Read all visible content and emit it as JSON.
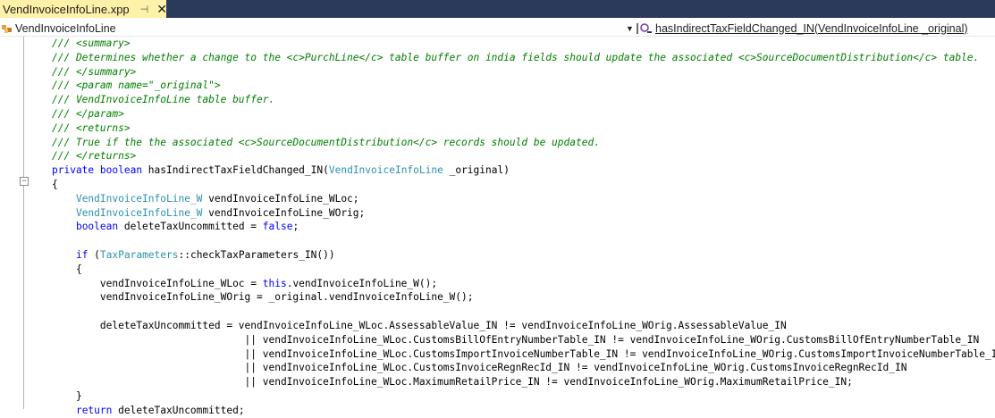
{
  "tab": {
    "title": "VendInvoiceInfoLine.xpp",
    "pin_glyph": "⊣",
    "close_glyph": "✕"
  },
  "nav": {
    "left": "VendInvoiceInfoLine",
    "right": "hasIndirectTaxFieldChanged_IN(VendInvoiceInfoLine _original)"
  },
  "colors": {
    "tabstrip": "#2b3a5b",
    "active_tab": "#fff1a8",
    "comment": "#008000",
    "keyword": "#0000ff",
    "type": "#2b91af"
  },
  "code": [
    [
      {
        "c": "c",
        "t": "/// <summary>"
      }
    ],
    [
      {
        "c": "c",
        "t": "/// Determines whether a change to the <c>PurchLine</c> table buffer on india fields should update the associated <c>SourceDocumentDistribution</c> table."
      }
    ],
    [
      {
        "c": "c",
        "t": "/// </summary>"
      }
    ],
    [
      {
        "c": "c",
        "t": "/// <param name=\"_original\">"
      }
    ],
    [
      {
        "c": "c",
        "t": "/// VendInvoiceInfoLine table buffer."
      }
    ],
    [
      {
        "c": "c",
        "t": "/// </param>"
      }
    ],
    [
      {
        "c": "c",
        "t": "/// <returns>"
      }
    ],
    [
      {
        "c": "c",
        "t": "/// True if the the associated <c>SourceDocumentDistribution</c> records should be updated."
      }
    ],
    [
      {
        "c": "c",
        "t": "/// </returns>"
      }
    ],
    [
      {
        "c": "k",
        "t": "private"
      },
      {
        "c": "",
        "t": " "
      },
      {
        "c": "k",
        "t": "boolean"
      },
      {
        "c": "",
        "t": " hasIndirectTaxFieldChanged_IN("
      },
      {
        "c": "t",
        "t": "VendInvoiceInfoLine"
      },
      {
        "c": "",
        "t": " _original)"
      }
    ],
    [
      {
        "c": "",
        "t": "{"
      }
    ],
    [
      {
        "c": "",
        "t": "    "
      },
      {
        "c": "t",
        "t": "VendInvoiceInfoLine_W"
      },
      {
        "c": "",
        "t": " vendInvoiceInfoLine_WLoc;"
      }
    ],
    [
      {
        "c": "",
        "t": "    "
      },
      {
        "c": "t",
        "t": "VendInvoiceInfoLine_W"
      },
      {
        "c": "",
        "t": " vendInvoiceInfoLine_WOrig;"
      }
    ],
    [
      {
        "c": "",
        "t": "    "
      },
      {
        "c": "k",
        "t": "boolean"
      },
      {
        "c": "",
        "t": " deleteTaxUncommitted = "
      },
      {
        "c": "k",
        "t": "false"
      },
      {
        "c": "",
        "t": ";"
      }
    ],
    [
      {
        "c": "",
        "t": ""
      }
    ],
    [
      {
        "c": "",
        "t": "    "
      },
      {
        "c": "k",
        "t": "if"
      },
      {
        "c": "",
        "t": " ("
      },
      {
        "c": "t",
        "t": "TaxParameters"
      },
      {
        "c": "",
        "t": "::checkTaxParameters_IN())"
      }
    ],
    [
      {
        "c": "",
        "t": "    {"
      }
    ],
    [
      {
        "c": "",
        "t": "        vendInvoiceInfoLine_WLoc = "
      },
      {
        "c": "k",
        "t": "this"
      },
      {
        "c": "",
        "t": ".vendInvoiceInfoLine_W();"
      }
    ],
    [
      {
        "c": "",
        "t": "        vendInvoiceInfoLine_WOrig = _original.vendInvoiceInfoLine_W();"
      }
    ],
    [
      {
        "c": "",
        "t": ""
      }
    ],
    [
      {
        "c": "",
        "t": "        deleteTaxUncommitted = vendInvoiceInfoLine_WLoc.AssessableValue_IN != vendInvoiceInfoLine_WOrig.AssessableValue_IN"
      }
    ],
    [
      {
        "c": "",
        "t": "                                || vendInvoiceInfoLine_WLoc.CustomsBillOfEntryNumberTable_IN != vendInvoiceInfoLine_WOrig.CustomsBillOfEntryNumberTable_IN"
      }
    ],
    [
      {
        "c": "",
        "t": "                                || vendInvoiceInfoLine_WLoc.CustomsImportInvoiceNumberTable_IN != vendInvoiceInfoLine_WOrig.CustomsImportInvoiceNumberTable_IN"
      }
    ],
    [
      {
        "c": "",
        "t": "                                || vendInvoiceInfoLine_WLoc.CustomsInvoiceRegnRecId_IN != vendInvoiceInfoLine_WOrig.CustomsInvoiceRegnRecId_IN"
      }
    ],
    [
      {
        "c": "",
        "t": "                                || vendInvoiceInfoLine_WLoc.MaximumRetailPrice_IN != vendInvoiceInfoLine_WOrig.MaximumRetailPrice_IN;"
      }
    ],
    [
      {
        "c": "",
        "t": "    }"
      }
    ],
    [
      {
        "c": "",
        "t": "    "
      },
      {
        "c": "k",
        "t": "return"
      },
      {
        "c": "",
        "t": " deleteTaxUncommitted;"
      }
    ]
  ]
}
